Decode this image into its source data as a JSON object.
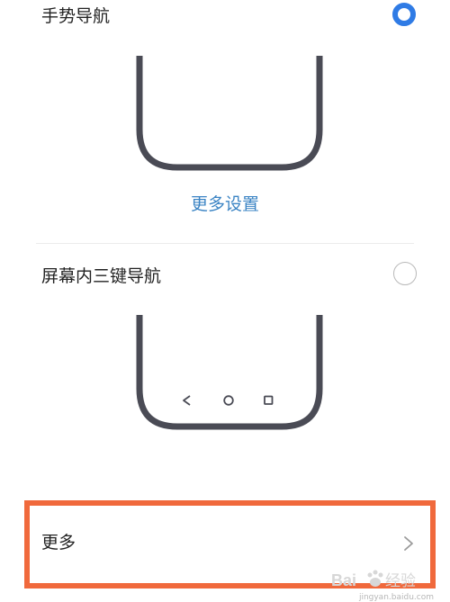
{
  "options": [
    {
      "title": "手势导航",
      "selected": true
    },
    {
      "title": "屏幕内三键导航",
      "selected": false
    }
  ],
  "more_settings_link": "更多设置",
  "more_row": {
    "label": "更多"
  },
  "colors": {
    "accent": "#2f7be5",
    "link": "#3b84c4",
    "highlight": "#f0693c"
  },
  "icons": [
    "radio-selected",
    "radio-unselected",
    "back-triangle-icon",
    "home-circle-icon",
    "recents-square-icon",
    "chevron-right-icon"
  ],
  "watermark": {
    "brand": "Bai 经验",
    "domain": "jingyan.baidu.com"
  }
}
